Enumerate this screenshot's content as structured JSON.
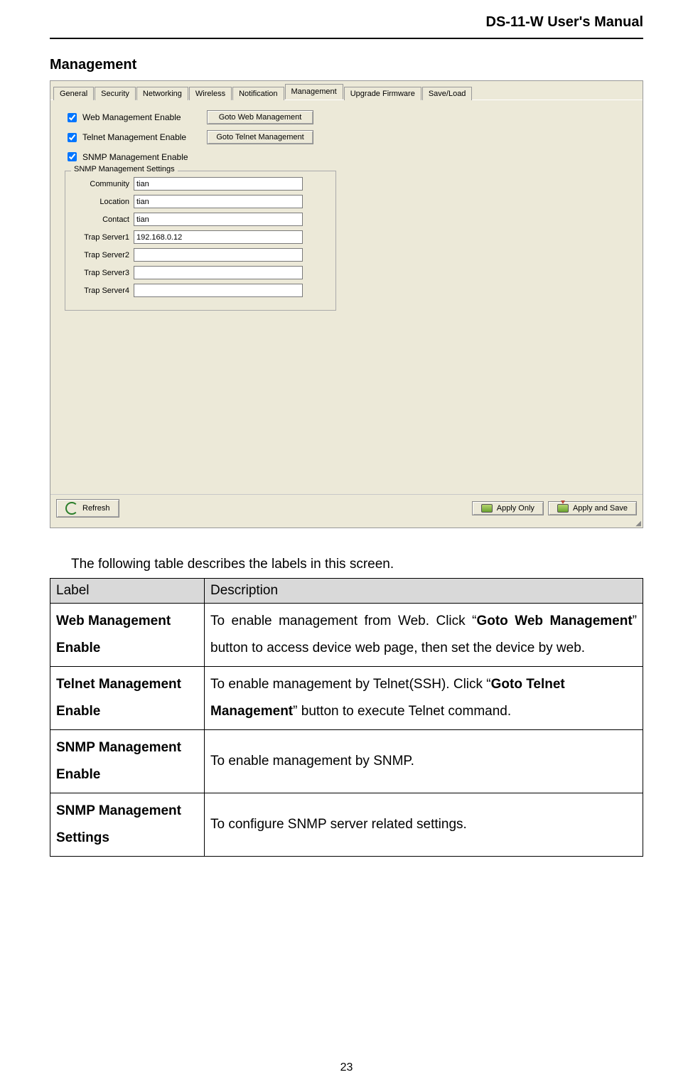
{
  "header": {
    "title": "DS-11-W User's Manual"
  },
  "section": {
    "heading": "Management"
  },
  "tabs": {
    "items": [
      {
        "label": "General"
      },
      {
        "label": "Security"
      },
      {
        "label": "Networking"
      },
      {
        "label": "Wireless"
      },
      {
        "label": "Notification"
      },
      {
        "label": "Management"
      },
      {
        "label": "Upgrade Firmware"
      },
      {
        "label": "Save/Load"
      }
    ],
    "active_index": 5
  },
  "management": {
    "web_enable_label": "Web Management Enable",
    "telnet_enable_label": "Telnet Management Enable",
    "snmp_enable_label": "SNMP Management Enable",
    "goto_web_button": "Goto Web Management",
    "goto_telnet_button": "Goto Telnet Management",
    "web_checked": true,
    "telnet_checked": true,
    "snmp_checked": true
  },
  "snmp_group": {
    "legend": "SNMP Management Settings",
    "rows": [
      {
        "label": "Community",
        "value": "tian"
      },
      {
        "label": "Location",
        "value": "tian"
      },
      {
        "label": "Contact",
        "value": "tian"
      },
      {
        "label": "Trap Server1",
        "value": "192.168.0.12"
      },
      {
        "label": "Trap Server2",
        "value": ""
      },
      {
        "label": "Trap Server3",
        "value": ""
      },
      {
        "label": "Trap Server4",
        "value": ""
      }
    ]
  },
  "footer": {
    "refresh": "Refresh",
    "apply_only": "Apply Only",
    "apply_and_save": "Apply and Save"
  },
  "table_intro": "The following table describes the labels in this screen.",
  "table": {
    "head_label": "Label",
    "head_desc": "Description",
    "rows": [
      {
        "label": "Web Management Enable",
        "desc_pre": "To enable management from Web.   Click “",
        "desc_bold": "Goto Web Management",
        "desc_post": "” button to access device web page, then set the device by web."
      },
      {
        "label": "Telnet Management Enable",
        "desc_pre": "To enable management by Telnet(SSH). Click “",
        "desc_bold": "Goto Telnet Management",
        "desc_post": "” button to execute Telnet command."
      },
      {
        "label": "SNMP Management Enable",
        "desc_pre": "To enable management by SNMP.",
        "desc_bold": "",
        "desc_post": ""
      },
      {
        "label": "SNMP Management Settings",
        "desc_pre": "To configure SNMP server related settings.",
        "desc_bold": "",
        "desc_post": ""
      }
    ]
  },
  "page_number": "23"
}
